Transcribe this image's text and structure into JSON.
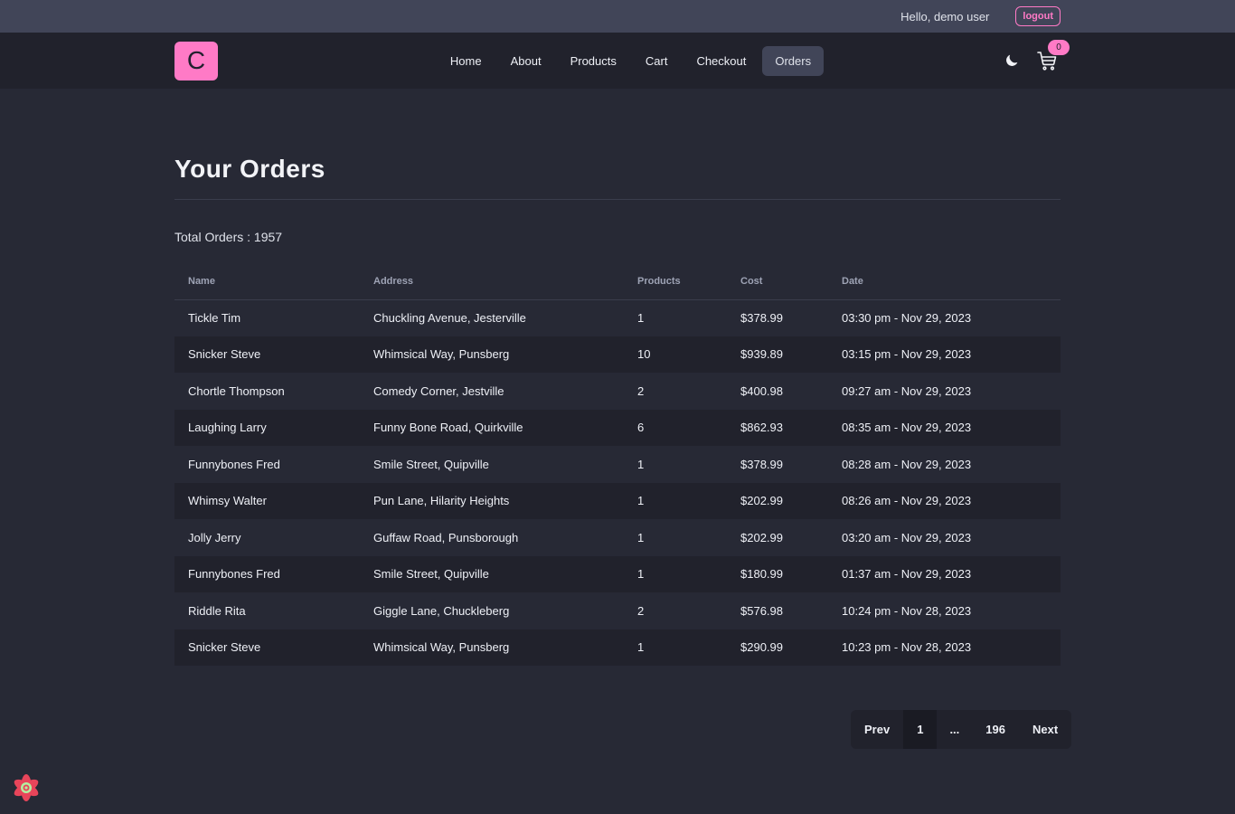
{
  "topbar": {
    "greeting": "Hello, demo user",
    "logout_label": "logout"
  },
  "navbar": {
    "logo_letter": "C",
    "links": [
      {
        "label": "Home"
      },
      {
        "label": "About"
      },
      {
        "label": "Products"
      },
      {
        "label": "Cart"
      },
      {
        "label": "Checkout"
      },
      {
        "label": "Orders",
        "active": true
      }
    ],
    "theme_icon": "moon-icon",
    "cart_icon": "cart-icon",
    "cart_count": "0"
  },
  "main": {
    "title": "Your Orders",
    "total_orders": "Total Orders : 1957",
    "table": {
      "headers": [
        "Name",
        "Address",
        "Products",
        "Cost",
        "Date"
      ],
      "rows": [
        [
          "Tickle Tim",
          "Chuckling Avenue, Jesterville",
          "1",
          "$378.99",
          "03:30 pm - Nov 29, 2023"
        ],
        [
          "Snicker Steve",
          "Whimsical Way, Punsberg",
          "10",
          "$939.89",
          "03:15 pm - Nov 29, 2023"
        ],
        [
          "Chortle Thompson",
          "Comedy Corner, Jestville",
          "2",
          "$400.98",
          "09:27 am - Nov 29, 2023"
        ],
        [
          "Laughing Larry",
          "Funny Bone Road, Quirkville",
          "6",
          "$862.93",
          "08:35 am - Nov 29, 2023"
        ],
        [
          "Funnybones Fred",
          "Smile Street, Quipville",
          "1",
          "$378.99",
          "08:28 am - Nov 29, 2023"
        ],
        [
          "Whimsy Walter",
          "Pun Lane, Hilarity Heights",
          "1",
          "$202.99",
          "08:26 am - Nov 29, 2023"
        ],
        [
          "Jolly Jerry",
          "Guffaw Road, Punsborough",
          "1",
          "$202.99",
          "03:20 am - Nov 29, 2023"
        ],
        [
          "Funnybones Fred",
          "Smile Street, Quipville",
          "1",
          "$180.99",
          "01:37 am - Nov 29, 2023"
        ],
        [
          "Riddle Rita",
          "Giggle Lane, Chuckleberg",
          "2",
          "$576.98",
          "10:24 pm - Nov 28, 2023"
        ],
        [
          "Snicker Steve",
          "Whimsical Way, Punsberg",
          "1",
          "$290.99",
          "10:23 pm - Nov 28, 2023"
        ]
      ]
    }
  },
  "pagination": {
    "prev_label": "Prev",
    "pages": [
      "1",
      "...",
      "196"
    ],
    "active_page": "1",
    "next_label": "Next"
  },
  "colors": {
    "accent": "#ff7ac6",
    "background": "#272935",
    "navbar": "#21222c",
    "topbar": "#414558"
  }
}
